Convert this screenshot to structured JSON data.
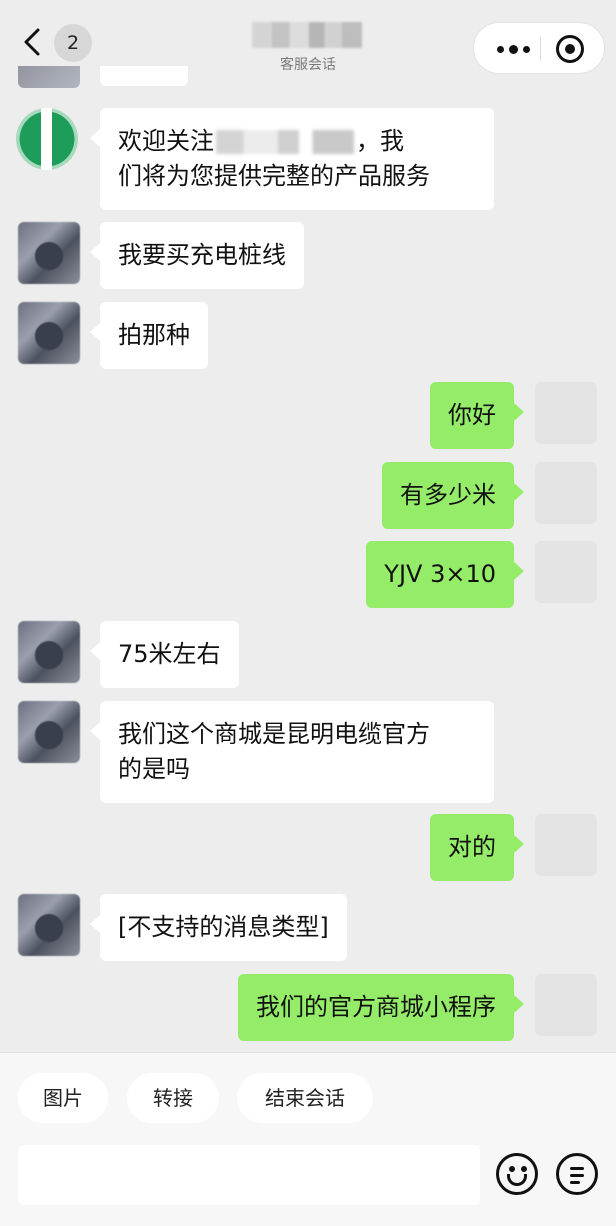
{
  "header": {
    "unread_count": "2",
    "subtitle": "客服会话"
  },
  "messages": [
    {
      "side": "left",
      "avatar": "green",
      "text_a": "欢迎关注",
      "text_b": "，我\n们将为您提供完整的产品服务"
    },
    {
      "side": "left",
      "text": "我要买充电桩线"
    },
    {
      "side": "left",
      "text": "拍那种"
    },
    {
      "side": "right",
      "text": "你好"
    },
    {
      "side": "right",
      "text": "有多少米"
    },
    {
      "side": "right",
      "text": "YJV 3×10"
    },
    {
      "side": "left",
      "text": "75米左右"
    },
    {
      "side": "left",
      "text": "我们这个商城是昆明电缆官方\n的是吗"
    },
    {
      "side": "right",
      "text": "对的"
    },
    {
      "side": "left",
      "text": "[不支持的消息类型]"
    },
    {
      "side": "right",
      "text": "我们的官方商城小程序"
    }
  ],
  "bottom_bar": {
    "quick_actions": [
      "图片",
      "转接",
      "结束会话"
    ],
    "input_value": ""
  },
  "colors": {
    "background": "#ededed",
    "outgoing_bubble": "#95ec69",
    "incoming_bubble": "#ffffff"
  },
  "icons": [
    "back-arrow-icon",
    "more-dots-icon",
    "close-target-icon",
    "emoji-icon",
    "menu-icon"
  ]
}
